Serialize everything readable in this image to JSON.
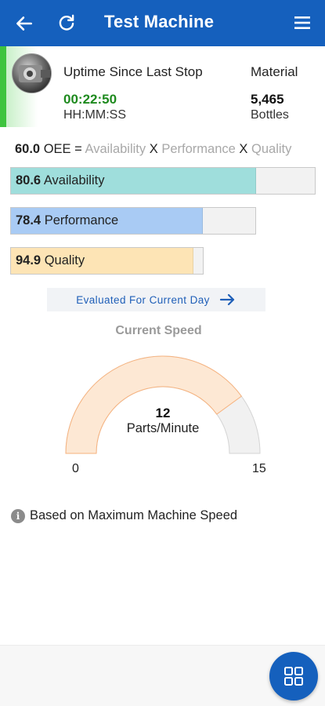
{
  "header": {
    "title": "Test Machine",
    "back_icon": "arrow-left-icon",
    "refresh_icon": "refresh-icon",
    "menu_icon": "hamburger-menu-icon"
  },
  "machine": {
    "status_color": "#3ec43e",
    "uptime_label": "Uptime Since Last Stop",
    "uptime_value": "00:22:50",
    "uptime_unit": "HH:MM:SS",
    "material_label": "Material",
    "material_value": "5,465",
    "material_unit": "Bottles"
  },
  "oee": {
    "value": "60.0",
    "equals": "OEE =",
    "availability_word": "Availability",
    "performance_word": "Performance",
    "quality_word": "Quality",
    "times": "X"
  },
  "metrics": [
    {
      "value": "80.6",
      "label": "Availability",
      "percent": 80.6,
      "color": "#9fdedc"
    },
    {
      "value": "78.4",
      "label": "Performance",
      "percent": 78.4,
      "color": "#a9cbf4"
    },
    {
      "value": "94.9",
      "label": "Quality",
      "percent": 94.9,
      "color": "#fde4b5"
    }
  ],
  "evaluation": {
    "label": "Evaluated For Current Day",
    "icon": "arrow-right-icon"
  },
  "speed": {
    "title": "Current Speed",
    "value": "12",
    "unit": "Parts/Minute",
    "min": "0",
    "max": "15",
    "current": 12,
    "maximum": 15,
    "fill_color": "#fde8d4",
    "stroke_color": "#f6b27e"
  },
  "info": {
    "icon": "info-icon",
    "text": "Based on Maximum Machine Speed"
  },
  "fab": {
    "icon": "grid-icon"
  }
}
